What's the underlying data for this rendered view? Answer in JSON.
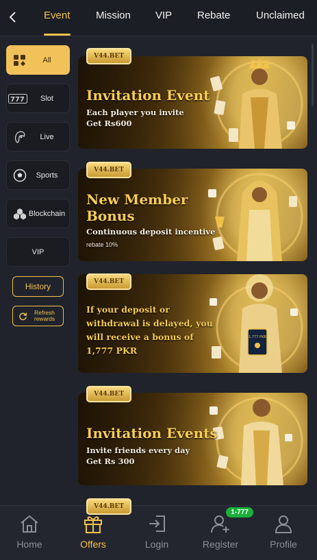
{
  "topbar": {
    "tabs": [
      "Event",
      "Mission",
      "VIP",
      "Rebate",
      "Unclaimed"
    ],
    "active_tab": "Event"
  },
  "sidebar": {
    "items": [
      {
        "label": "All",
        "icon": "grid-cards-icon",
        "active": true
      },
      {
        "label": "Slot",
        "icon": "slot-777-icon"
      },
      {
        "label": "Live",
        "icon": "dealer-icon"
      },
      {
        "label": "Sports",
        "icon": "soccer-ball-icon"
      },
      {
        "label": "Blockchain",
        "icon": "blockchain-icon"
      },
      {
        "label": "VIP",
        "icon": ""
      }
    ],
    "history_label": "History",
    "refresh_label_1": "Refresh",
    "refresh_label_2": "rewards"
  },
  "banners": [
    {
      "tag": "V44.BET",
      "title": "Invitation Event",
      "lines": [
        "Each player you invite",
        "Get Rs600"
      ]
    },
    {
      "tag": "V44.BET",
      "title_lines": [
        "New Member",
        "Bonus"
      ],
      "lines": [
        "Continuous deposit incentive"
      ],
      "note": "rebate 10%"
    },
    {
      "tag": "V44.BET",
      "warn_lines": [
        "If your deposit or",
        "withdrawal is delayed, you",
        "will receive a bonus of",
        "1,777 PKR"
      ],
      "card_text": "1,777 PKR"
    },
    {
      "tag": "V44.BET",
      "title": "Invitation Events",
      "lines": [
        "Invite friends every day",
        "Get Rs 300"
      ]
    },
    {
      "tag": "V44.BET"
    }
  ],
  "bottomnav": {
    "items": [
      {
        "label": "Home",
        "icon": "home-icon"
      },
      {
        "label": "Offers",
        "icon": "gift-icon",
        "active": true
      },
      {
        "label": "Login",
        "icon": "login-icon"
      },
      {
        "label": "Register",
        "icon": "add-user-icon"
      },
      {
        "label": "Profile",
        "icon": "profile-icon"
      }
    ],
    "register_badge": "1-777"
  },
  "colors": {
    "accent": "#f3c14d",
    "background": "#20232b",
    "badge": "#19b13a"
  }
}
